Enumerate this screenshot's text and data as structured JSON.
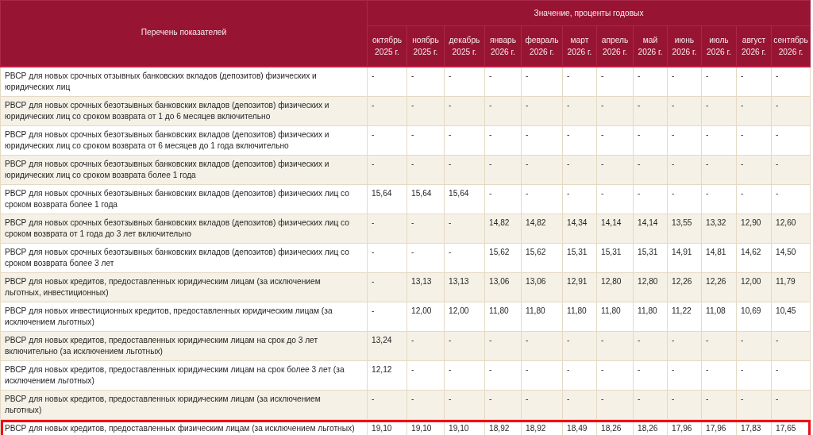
{
  "table": {
    "header": {
      "indicator_column": "Перечень показателей",
      "value_group": "Значение, проценты годовых",
      "months": [
        "октябрь 2025 г.",
        "ноябрь 2025 г.",
        "декабрь 2025 г.",
        "январь 2026 г.",
        "февраль 2026 г.",
        "март 2026 г.",
        "апрель 2026 г.",
        "май 2026 г.",
        "июнь 2026 г.",
        "июль 2026 г.",
        "август 2026 г.",
        "сентябрь 2026 г."
      ]
    },
    "rows": [
      {
        "indicator": "РВСР для новых срочных отзывных банковских вкладов (депозитов) физических и юридических лиц",
        "values": [
          "-",
          "-",
          "-",
          "-",
          "-",
          "-",
          "-",
          "-",
          "-",
          "-",
          "-",
          "-"
        ],
        "highlighted": false
      },
      {
        "indicator": "РВСР для новых срочных безотзывных банковских вкладов (депозитов) физических и юридических лиц со сроком возврата от 1 до 6 месяцев включительно",
        "values": [
          "-",
          "-",
          "-",
          "-",
          "-",
          "-",
          "-",
          "-",
          "-",
          "-",
          "-",
          "-"
        ],
        "highlighted": false
      },
      {
        "indicator": "РВСР для новых срочных безотзывных банковских вкладов (депозитов) физических и юридических лиц со сроком возврата от 6 месяцев до 1 года включительно",
        "values": [
          "-",
          "-",
          "-",
          "-",
          "-",
          "-",
          "-",
          "-",
          "-",
          "-",
          "-",
          "-"
        ],
        "highlighted": false
      },
      {
        "indicator": "РВСР для новых срочных безотзывных банковских вкладов (депозитов) физических и юридических лиц со сроком возврата более 1 года",
        "values": [
          "-",
          "-",
          "-",
          "-",
          "-",
          "-",
          "-",
          "-",
          "-",
          "-",
          "-",
          "-"
        ],
        "highlighted": false
      },
      {
        "indicator": "РВСР для новых срочных безотзывных банковских вкладов (депозитов) физических лиц со сроком возврата более 1 года",
        "values": [
          "15,64",
          "15,64",
          "15,64",
          "-",
          "-",
          "-",
          "-",
          "-",
          "-",
          "-",
          "-",
          "-"
        ],
        "highlighted": false
      },
      {
        "indicator": "РВСР для новых срочных безотзывных банковских вкладов (депозитов) физических лиц со сроком возврата от 1 года до 3 лет включительно",
        "values": [
          "-",
          "-",
          "-",
          "14,82",
          "14,82",
          "14,34",
          "14,14",
          "14,14",
          "13,55",
          "13,32",
          "12,90",
          "12,60"
        ],
        "highlighted": false
      },
      {
        "indicator": "РВСР для новых срочных безотзывных банковских вкладов (депозитов) физических лиц со сроком возврата более 3 лет",
        "values": [
          "-",
          "-",
          "-",
          "15,62",
          "15,62",
          "15,31",
          "15,31",
          "15,31",
          "14,91",
          "14,81",
          "14,62",
          "14,50"
        ],
        "highlighted": false
      },
      {
        "indicator": "РВСР для новых кредитов, предоставленных юридическим лицам (за исключением льготных, инвестиционных)",
        "values": [
          "-",
          "13,13",
          "13,13",
          "13,06",
          "13,06",
          "12,91",
          "12,80",
          "12,80",
          "12,26",
          "12,26",
          "12,00",
          "11,79"
        ],
        "highlighted": false
      },
      {
        "indicator": "РВСР для новых инвестиционных кредитов, предоставленных юридическим лицам (за исключением льготных)",
        "values": [
          "-",
          "12,00",
          "12,00",
          "11,80",
          "11,80",
          "11,80",
          "11,80",
          "11,80",
          "11,22",
          "11,08",
          "10,69",
          "10,45"
        ],
        "highlighted": false
      },
      {
        "indicator": "РВСР для новых кредитов, предоставленных юридическим лицам на срок до 3 лет включительно (за исключением льготных)",
        "values": [
          "13,24",
          "-",
          "-",
          "-",
          "-",
          "-",
          "-",
          "-",
          "-",
          "-",
          "-",
          "-"
        ],
        "highlighted": false
      },
      {
        "indicator": "РВСР для новых кредитов, предоставленных юридическим лицам на срок более 3 лет (за исключением льготных)",
        "values": [
          "12,12",
          "-",
          "-",
          "-",
          "-",
          "-",
          "-",
          "-",
          "-",
          "-",
          "-",
          "-"
        ],
        "highlighted": false
      },
      {
        "indicator": "РВСР для новых кредитов, предоставленных юридическим лицам (за исключением льготных)",
        "values": [
          "-",
          "-",
          "-",
          "-",
          "-",
          "-",
          "-",
          "-",
          "-",
          "-",
          "-",
          "-"
        ],
        "highlighted": false
      },
      {
        "indicator": "РВСР для новых кредитов, предоставленных физическим лицам (за исключением льготных)",
        "values": [
          "19,10",
          "19,10",
          "19,10",
          "18,92",
          "18,92",
          "18,49",
          "18,26",
          "18,26",
          "17,96",
          "17,96",
          "17,83",
          "17,65"
        ],
        "highlighted": true
      }
    ]
  }
}
